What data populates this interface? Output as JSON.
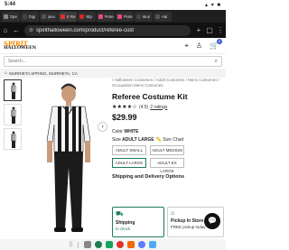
{
  "status_bar": {
    "time": "5:44",
    "right_icons": "▴ ▾ ■"
  },
  "tabs": [
    {
      "label": "Ope",
      "color": "#888888"
    },
    {
      "label": "Digi",
      "color": "#444444"
    },
    {
      "label": "jano",
      "color": "#555555"
    },
    {
      "label": "S Re",
      "color": "#e03131"
    },
    {
      "label": "http",
      "color": "#c92a2a"
    },
    {
      "label": "Pinte",
      "color": "#e64980"
    },
    {
      "label": "Pinte",
      "color": "#e64980"
    },
    {
      "label": "Mus",
      "color": "#444444"
    },
    {
      "label": "Hal",
      "color": "#555555"
    }
  ],
  "url_bar": {
    "url": "spirithalloween.com/product/referee-cost"
  },
  "header": {
    "logo_line1": "SPIRIT",
    "logo_line2": "HALLOWEEN",
    "cart_count": "0"
  },
  "search": {
    "placeholder": "Search..."
  },
  "store": {
    "label": "MURRIETA SPRING, MURRIETA, CA"
  },
  "product": {
    "breadcrumbs": "/ Halloween Costumes / Adult Costumes / Mens Costumes / Occupation Mens Costumes",
    "title": "Referee Costume Kit",
    "stars": "★★★★☆",
    "rating": "(4.5)",
    "ratings_link": "2 ratings",
    "price": "$29.99",
    "color_label": "Color",
    "color_value": "WHITE",
    "size_label": "Size",
    "size_value": "ADULT LARGE",
    "size_chart": "Size Chart",
    "sizes": [
      "ADULT SMALL",
      "ADULT MEDIUM",
      "ADULT LARGE",
      "ADULT EX LARGE"
    ],
    "shipping_title": "Shipping and Delivery Options",
    "shipping_card": {
      "title": "Shipping",
      "status": "In Stock"
    },
    "pickup_card": {
      "title": "Pickup In Store",
      "status": "FREE pickup today"
    }
  },
  "dock_colors": [
    "#888888",
    "#1c7c54",
    "#1aa260",
    "#e03131",
    "#f76707",
    "#5c7cfa",
    "#4dabf7"
  ]
}
